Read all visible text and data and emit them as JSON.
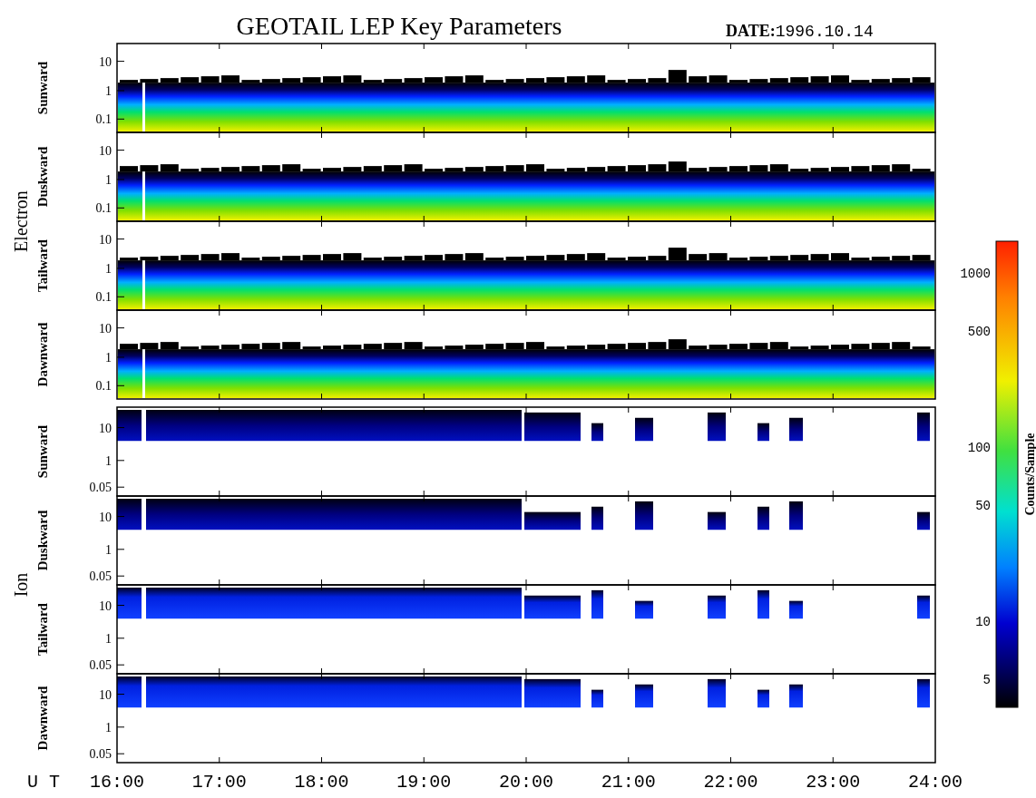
{
  "title": "GEOTAIL LEP Key Parameters",
  "date": "**DATE:**1996.10.14",
  "groups": [
    {
      "name": "Electron",
      "kind": "electron",
      "panels": [
        {
          "label": "Sunward",
          "yticks": [
            "10",
            "1",
            "0.1"
          ]
        },
        {
          "label": "Duskward",
          "yticks": [
            "10",
            "1",
            "0.1"
          ]
        },
        {
          "label": "Tailward",
          "yticks": [
            "10",
            "1",
            "0.1"
          ]
        },
        {
          "label": "Dawnward",
          "yticks": [
            "10",
            "1",
            "0.1"
          ]
        }
      ]
    },
    {
      "name": "Ion",
      "kind": "ion",
      "panels": [
        {
          "label": "Sunward",
          "yticks": [
            "10",
            "1",
            "0.05"
          ]
        },
        {
          "label": "Duskward",
          "yticks": [
            "10",
            "1",
            "0.05"
          ]
        },
        {
          "label": "Tailward",
          "yticks": [
            "10",
            "1",
            "0.05"
          ]
        },
        {
          "label": "Dawnward",
          "yticks": [
            "10",
            "1",
            "0.05"
          ]
        }
      ]
    }
  ],
  "x_axis": {
    "label": "U T",
    "ticks": [
      "16:00",
      "17:00",
      "18:00",
      "19:00",
      "20:00",
      "21:00",
      "22:00",
      "23:00",
      "24:00"
    ]
  },
  "colorbar": {
    "label": "Counts/Sample",
    "ticks": [
      "1000",
      "500",
      "100",
      "50",
      "10",
      "5"
    ]
  }
}
